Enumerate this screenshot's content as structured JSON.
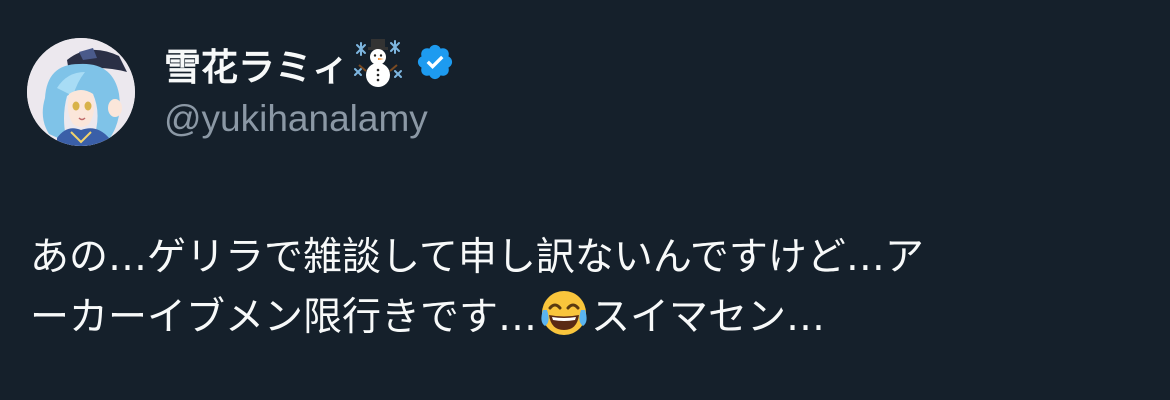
{
  "author": {
    "display_name": "雪花ラミィ",
    "name_emoji_icon": "snowman-with-snowflakes-emoji",
    "verified_icon": "verified-badge-icon",
    "handle": "@yukihanalamy",
    "avatar_icon": "profile-avatar"
  },
  "tweet": {
    "line1": "あの…ゲリラで雑談して申し訳ないんですけど…ア",
    "line2_before_emoji": "ーカーイブメン限行きです…",
    "inline_emoji_icon": "face-with-tears-of-joy-emoji",
    "line2_after_emoji": "スイマセン…"
  },
  "colors": {
    "background": "#15202b",
    "text_primary": "#f7f9f9",
    "text_secondary": "#8b98a5",
    "verified_blue": "#1d9bf0"
  }
}
